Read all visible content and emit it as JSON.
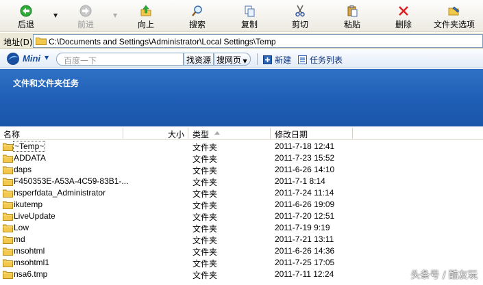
{
  "toolbar": {
    "back_label": "后退",
    "forward_label": "前进",
    "up_label": "向上",
    "search_label": "搜索",
    "copy_label": "复制",
    "cut_label": "剪切",
    "paste_label": "粘贴",
    "delete_label": "删除",
    "folder_options_label": "文件夹选项",
    "icons": [
      "back-arrow-icon",
      "forward-arrow-icon",
      "up-folder-icon",
      "search-magnifier-icon",
      "copy-icon",
      "cut-scissors-icon",
      "paste-clipboard-icon",
      "delete-x-icon",
      "folder-options-icon"
    ]
  },
  "address": {
    "label": "地址(D)",
    "path": "C:\\Documents and Settings\\Administrator\\Local Settings\\Temp"
  },
  "mini": {
    "logo_text": "Mini",
    "search_placeholder": "百度一下",
    "find_resources_label": "找资源",
    "search_web_label": "搜网页",
    "new_label": "新建",
    "task_list_label": "任务列表"
  },
  "task_pane": {
    "title": "文件和文件夹任务"
  },
  "columns": {
    "name": "名称",
    "size": "大小",
    "type": "类型",
    "modified": "修改日期"
  },
  "files": [
    {
      "name": "~Temp~",
      "type": "文件夹",
      "modified": "2011-7-18 12:41"
    },
    {
      "name": "ADDATA",
      "type": "文件夹",
      "modified": "2011-7-23 15:52"
    },
    {
      "name": "daps",
      "type": "文件夹",
      "modified": "2011-6-26 14:10"
    },
    {
      "name": "F450353E-A53A-4C59-83B1-...",
      "type": "文件夹",
      "modified": "2011-7-1 8:14"
    },
    {
      "name": "hsperfdata_Administrator",
      "type": "文件夹",
      "modified": "2011-7-24 11:14"
    },
    {
      "name": "ikutemp",
      "type": "文件夹",
      "modified": "2011-6-26 19:09"
    },
    {
      "name": "LiveUpdate",
      "type": "文件夹",
      "modified": "2011-7-20 12:51"
    },
    {
      "name": "Low",
      "type": "文件夹",
      "modified": "2011-7-19 9:19"
    },
    {
      "name": "md",
      "type": "文件夹",
      "modified": "2011-7-21 13:11"
    },
    {
      "name": "msohtml",
      "type": "文件夹",
      "modified": "2011-6-26 14:36"
    },
    {
      "name": "msohtml1",
      "type": "文件夹",
      "modified": "2011-7-25 17:05"
    },
    {
      "name": "nsa6.tmp",
      "type": "文件夹",
      "modified": "2011-7-11 12:24"
    }
  ],
  "colors": {
    "task_pane_blue": "#1f5eb6",
    "folder_yellow": "#f2c94c",
    "delete_red": "#e02020"
  },
  "watermark": "头条号 / 酷友玩"
}
